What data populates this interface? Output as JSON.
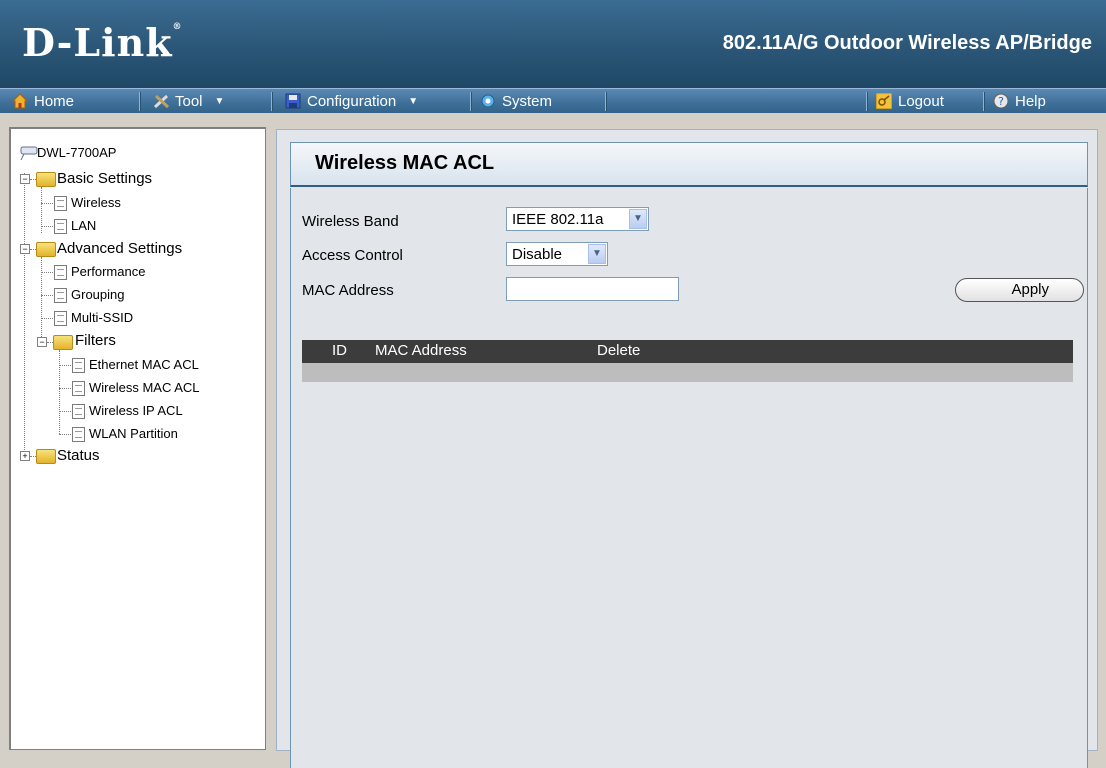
{
  "header": {
    "logo": "D-Link",
    "product_title": "802.11A/G Outdoor Wireless AP/Bridge"
  },
  "menu": {
    "home": "Home",
    "tool": "Tool",
    "configuration": "Configuration",
    "system": "System",
    "logout": "Logout",
    "help": "Help"
  },
  "tree": {
    "root": "DWL-7700AP",
    "basic_settings": "Basic Settings",
    "wireless": "Wireless",
    "lan": "LAN",
    "advanced_settings": "Advanced Settings",
    "performance": "Performance",
    "grouping": "Grouping",
    "multi_ssid": "Multi-SSID",
    "filters": "Filters",
    "ethernet_mac_acl": "Ethernet MAC ACL",
    "wireless_mac_acl": "Wireless MAC ACL",
    "wireless_ip_acl": "Wireless IP ACL",
    "wlan_partition": "WLAN Partition",
    "status": "Status"
  },
  "panel": {
    "title": "Wireless MAC ACL",
    "wireless_band_label": "Wireless Band",
    "wireless_band_value": "IEEE 802.11a",
    "access_control_label": "Access Control",
    "access_control_value": "Disable",
    "mac_address_label": "MAC Address",
    "mac_address_value": "",
    "apply_label": "Apply"
  },
  "table": {
    "columns": [
      "ID",
      "MAC Address",
      "Delete"
    ]
  }
}
